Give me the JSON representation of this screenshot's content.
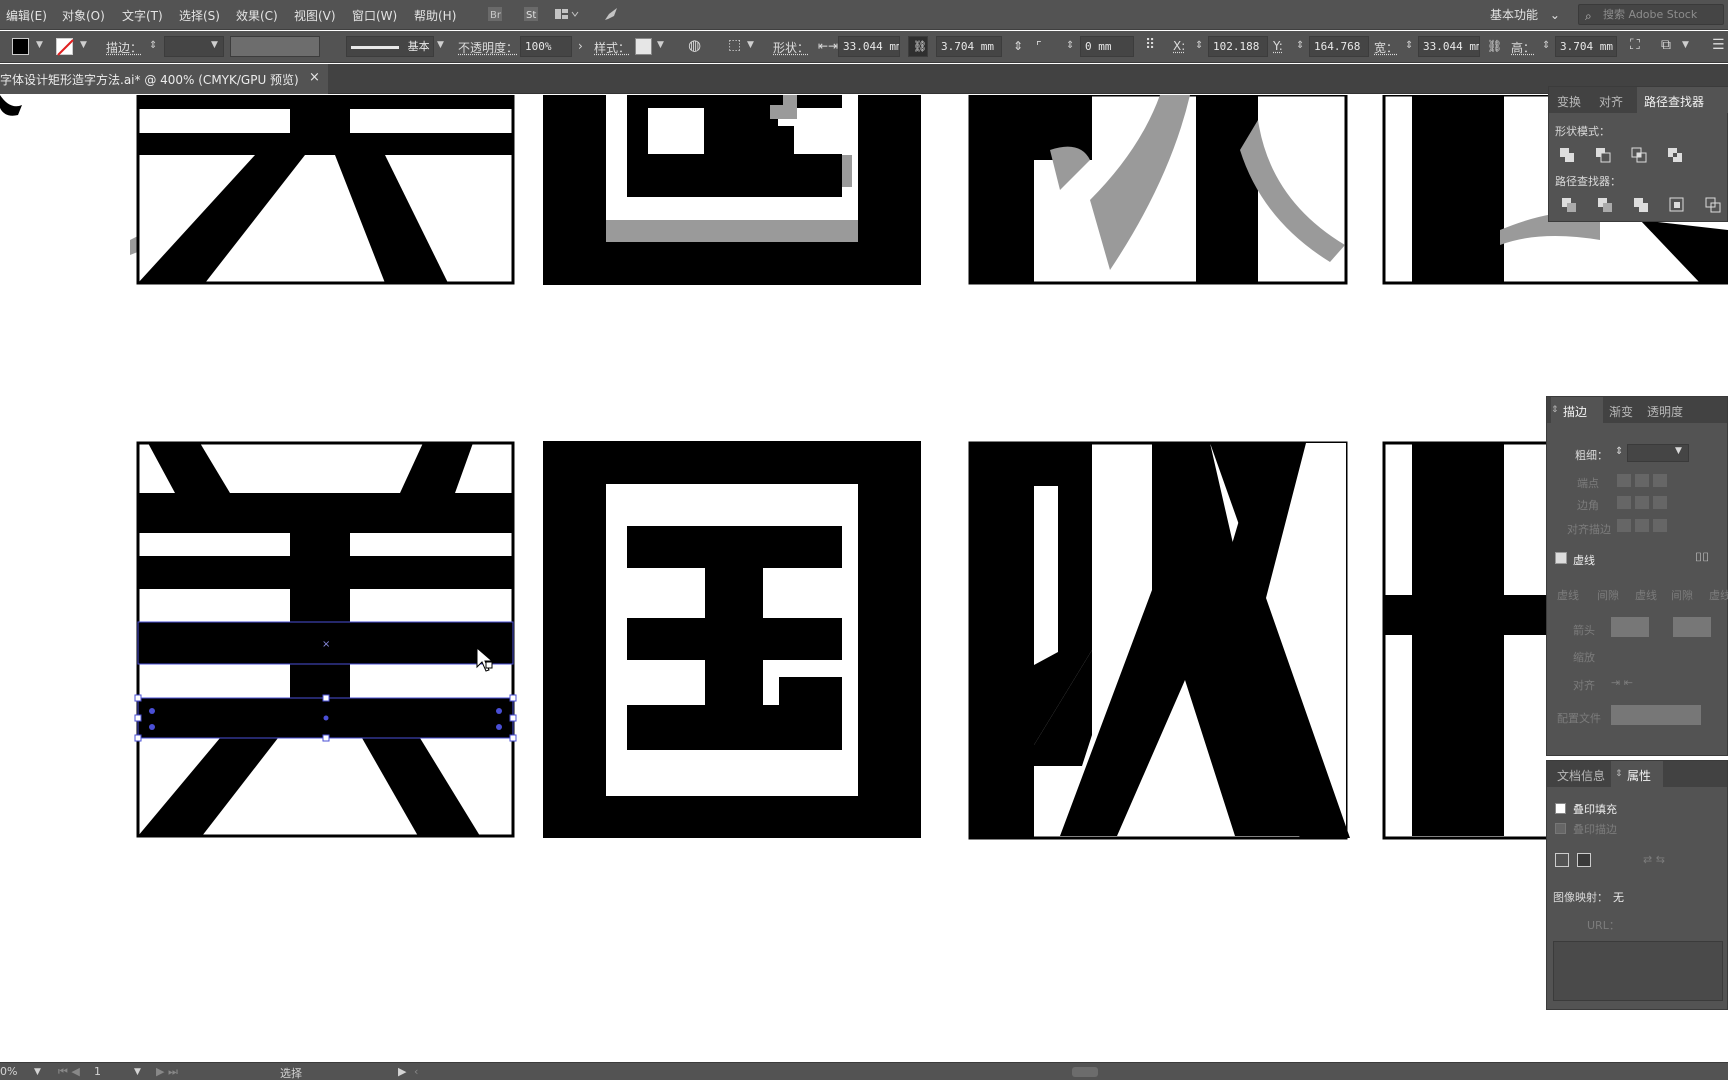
{
  "menubar": {
    "items": [
      "编辑(E)",
      "对象(O)",
      "文字(T)",
      "选择(S)",
      "效果(C)",
      "视图(V)",
      "窗口(W)",
      "帮助(H)"
    ],
    "workspace_label": "基本功能",
    "stock_search_placeholder": "搜索 Adobe Stock"
  },
  "controlbar": {
    "stroke_label": "描边：",
    "stroke_style_label": "基本",
    "opacity_label": "不透明度：",
    "opacity_value": "100%",
    "style_label": "样式：",
    "shape_label": "形状：",
    "shape_width": "33.044 mm",
    "shape_height": "3.704 mm",
    "corner_value": "0 mm",
    "x_label": "X:",
    "x_value": "102.188 n",
    "y_label": "Y:",
    "y_value": "164.768 n",
    "w_label": "宽：",
    "w_value": "33.044 mm",
    "h_label": "高：",
    "h_value": "3.704 mm"
  },
  "document": {
    "tab_title": "字体设计矩形造字方法.ai* @ 400% (CMYK/GPU 预览)",
    "close_glyph": "×"
  },
  "panels": {
    "pathfinder": {
      "tabs": [
        "变换",
        "对齐",
        "路径查找器"
      ],
      "active_tab": "路径查找器",
      "shape_modes_label": "形状模式：",
      "pathfinders_label": "路径查找器："
    },
    "stroke": {
      "tabs": [
        "描边",
        "渐变",
        "透明度"
      ],
      "active_tab": "描边",
      "weight_label": "粗细：",
      "cap_label": "端点",
      "corner_label": "边角",
      "align_label": "对齐描边",
      "dashed_label": "虚线",
      "dash_labels": [
        "虚线",
        "间隙",
        "虚线",
        "间隙",
        "虚线",
        "间隙"
      ],
      "arrow_label": "箭头",
      "scale_label": "缩放",
      "align2_label": "对齐",
      "profile_label": "配置文件"
    },
    "attributes": {
      "tabs": [
        "文档信息",
        "属性"
      ],
      "active_tab": "属性",
      "overprint_fill_label": "叠印填充",
      "overprint_stroke_label": "叠印描边",
      "image_map_label": "图像映射：",
      "image_map_value": "无",
      "url_label": "URL："
    }
  },
  "statusbar": {
    "zoom": "0%",
    "page": "1",
    "tool": "选择"
  },
  "colors": {
    "ui_bg": "#535353",
    "ui_dark": "#424242",
    "selection": "#4a4fd6",
    "ink": "#000000",
    "guide_gray": "#9a9a9a"
  }
}
